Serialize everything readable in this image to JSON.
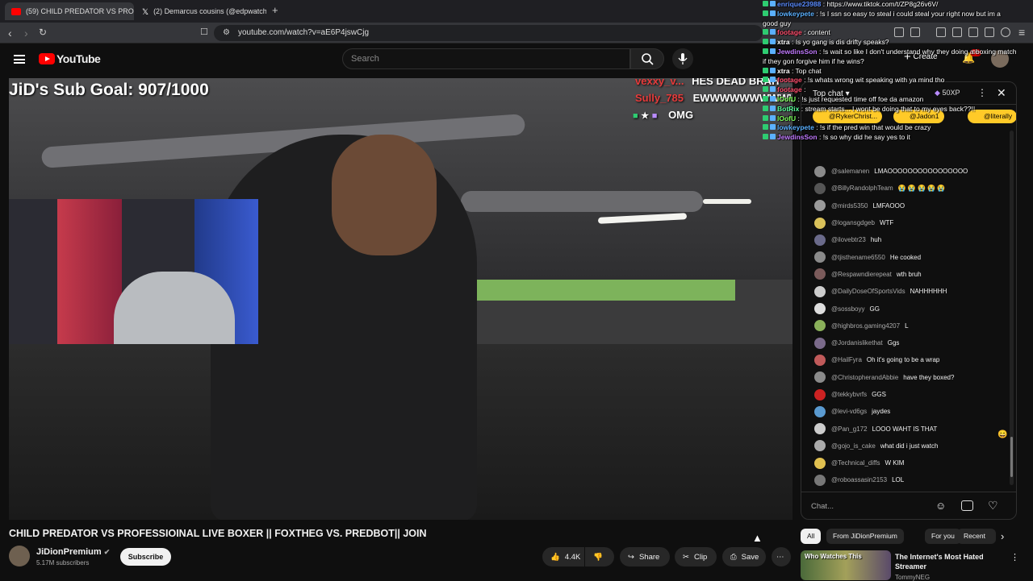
{
  "browser": {
    "tabs": [
      {
        "label": "(59) CHILD PREDATOR VS PRO",
        "color": "#ff0000"
      },
      {
        "label": "(2) Demarcus cousins (@edpwatch_)",
        "color": "#000000"
      }
    ],
    "new_tab": "+",
    "url": "youtube.com/watch?v=aE6P4jswCjg"
  },
  "yt": {
    "logo": "YouTube",
    "search_placeholder": "Search",
    "create": "Create",
    "notif_count": "9+"
  },
  "video": {
    "sub_goal": "JiD's Sub Goal: 907/1000",
    "overlay_msgs": [
      {
        "user": "vexxy_v...",
        "text": "HES DEAD BRAH",
        "color": "#e63b3b"
      },
      {
        "user": "Sully_785",
        "text": "EWWWWWWWWWW",
        "color": "#e63b3b"
      },
      {
        "user": "",
        "text": "OMG",
        "color": "#ffffff"
      }
    ],
    "title": "CHILD PREDATOR VS PROFESSIOINAL LIVE BOXER || FOXTHEG VS. PREDBOT|| JOIN",
    "channel": "JiDionPremium",
    "subs": "5.17M subscribers",
    "subscribe": "Subscribe",
    "likes": "4.4K",
    "share": "Share",
    "clip": "Clip",
    "save": "Save"
  },
  "stream_chat": [
    {
      "user": "enrique23988",
      "text": "https://www.tiktok.com/t/ZP8g26v6V/",
      "color": "#5b8cff"
    },
    {
      "user": "lowkeypete",
      "text": "!s I ssn so easy to steal i could steal your right now but im a",
      "color": "#5bb0ff"
    },
    {
      "user": "",
      "text": "good guy",
      "color": "#ffffff"
    },
    {
      "user": "footage",
      "text": "content",
      "color": "#ff4f6e"
    },
    {
      "user": "xtra",
      "text": "Is yo gang is dis drifty speaks?",
      "color": "#ffffff"
    },
    {
      "user": "JewdinsSon",
      "text": "!s wait so like I don't understand why they doing a boxing match",
      "color": "#c17aff"
    },
    {
      "user": "",
      "text": "if they gon forgive him if he wins?",
      "color": "#ffffff"
    },
    {
      "user": "xtra",
      "text": "Top chat",
      "color": "#ffffff"
    },
    {
      "user": "footage",
      "text": "!s whats wrong wit speaking with ya mind tho",
      "color": "#ff4f6e"
    },
    {
      "user": "footage",
      "text": "",
      "color": "#ff4f6e"
    },
    {
      "user": "lOofU",
      "text": "!s just requested time off foe da amazon",
      "color": "#7cff5b"
    },
    {
      "user": "BotRix",
      "text": "stream starts... I wont be doing that to my eyes back??!!",
      "color": "#5bff9c"
    },
    {
      "user": "lOofU",
      "text": "",
      "color": "#7cff5b"
    },
    {
      "user": "lowkeypete",
      "text": "!s if the pred win that would be crazy",
      "color": "#5bb0ff"
    },
    {
      "user": "JewdinsSon",
      "text": "!s so why did he say yes to it",
      "color": "#c17aff"
    }
  ],
  "chat": {
    "title": "Top chat",
    "xp": "50XP",
    "pinned": [
      "@RykerChrist...",
      "@Jadon1",
      "@literally"
    ],
    "messages": [
      {
        "author": "@salemanen",
        "text": "LMAOOOOOOOOOOOOOOOO",
        "color": "#8a8a8a"
      },
      {
        "author": "@BillyRandolphTeam",
        "text": "😭 😭 😭 😭 😭",
        "color": "#555"
      },
      {
        "author": "@mirds5350",
        "text": "LMFAOOO",
        "color": "#999"
      },
      {
        "author": "@logansgdgeb",
        "text": "WTF",
        "color": "#d9c15a"
      },
      {
        "author": "@ilovebtr23",
        "text": "huh",
        "color": "#6a6a8a"
      },
      {
        "author": "@tjisthename6550",
        "text": "He cooked",
        "color": "#8a8a8a"
      },
      {
        "author": "@Respawndierepeat",
        "text": "wth bruh",
        "color": "#7a5a5a"
      },
      {
        "author": "@DailyDoseOfSportsVids",
        "text": "NAHHHHHH",
        "color": "#ccc"
      },
      {
        "author": "@sossboyy",
        "text": "GG",
        "color": "#ddd"
      },
      {
        "author": "@highbros.gaming4207",
        "text": "L",
        "color": "#8ab05a"
      },
      {
        "author": "@Jordanislikethat",
        "text": "Ggs",
        "color": "#7a6a8a"
      },
      {
        "author": "@HailFyra",
        "text": "Oh it's going to be a wrap",
        "color": "#c05a5a"
      },
      {
        "author": "@ChristopherandAbbie",
        "text": "have they boxed?",
        "color": "#8a8a8a"
      },
      {
        "author": "@tekkybvrfs",
        "text": "GGS",
        "color": "#cc2222"
      },
      {
        "author": "@levi-vd6gs",
        "text": "jaydes",
        "color": "#5a9ad0"
      },
      {
        "author": "@Pan_g172",
        "text": "LOOO WAHT IS THAT",
        "color": "#ccc"
      },
      {
        "author": "@gojo_is_cake",
        "text": "what did i just watch",
        "color": "#aaa"
      },
      {
        "author": "@Technical_diffs",
        "text": "W KIM",
        "color": "#e0c050"
      },
      {
        "author": "@roboassasin2153",
        "text": "LOL",
        "color": "#777"
      }
    ],
    "input_placeholder": "Chat..."
  },
  "recs": {
    "chips": [
      "All",
      "From JiDionPremium",
      "For you",
      "Recent"
    ],
    "thumb_text": "Who Watches This",
    "title": "The Internet's Most Hated Streamer",
    "author": "TommyNEG"
  }
}
